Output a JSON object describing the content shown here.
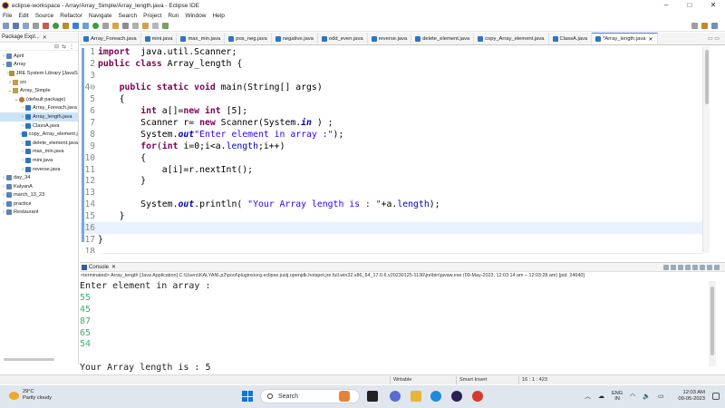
{
  "window": {
    "title": "eclipse-workspace - Array/Array_Simple/Array_length.java - Eclipse IDE",
    "controls": [
      "–",
      "□",
      "✕"
    ]
  },
  "menu": [
    "File",
    "Edit",
    "Source",
    "Refactor",
    "Navigate",
    "Search",
    "Project",
    "Run",
    "Window",
    "Help"
  ],
  "explorer": {
    "title": "Package Expl...",
    "tree": [
      {
        "label": "April",
        "indent": 0,
        "twisty": "›",
        "icon": "proj"
      },
      {
        "label": "Array",
        "indent": 0,
        "twisty": "⌄",
        "icon": "proj"
      },
      {
        "label": "JRE System Library [JavaSE-17]",
        "indent": 1,
        "twisty": "›",
        "icon": "lib"
      },
      {
        "label": "src",
        "indent": 1,
        "twisty": "›",
        "icon": "src"
      },
      {
        "label": "Array_Simple",
        "indent": 1,
        "twisty": "⌄",
        "icon": "src"
      },
      {
        "label": "(default package)",
        "indent": 2,
        "twisty": "⌄",
        "icon": "pkgi"
      },
      {
        "label": "Array_Foreach.java",
        "indent": 3,
        "twisty": "›",
        "icon": "java"
      },
      {
        "label": "Array_length.java",
        "indent": 3,
        "twisty": "›",
        "icon": "java",
        "selected": true
      },
      {
        "label": "ClassA.java",
        "indent": 3,
        "twisty": "›",
        "icon": "java"
      },
      {
        "label": "copy_Array_element.java",
        "indent": 3,
        "twisty": "›",
        "icon": "java"
      },
      {
        "label": "delete_element.java",
        "indent": 3,
        "twisty": "›",
        "icon": "java"
      },
      {
        "label": "max_min.java",
        "indent": 3,
        "twisty": "›",
        "icon": "java"
      },
      {
        "label": "mini.java",
        "indent": 3,
        "twisty": "›",
        "icon": "java"
      },
      {
        "label": "reverse.java",
        "indent": 3,
        "twisty": "›",
        "icon": "java"
      },
      {
        "label": "day_34",
        "indent": 0,
        "twisty": "›",
        "icon": "proj"
      },
      {
        "label": "KalyanA",
        "indent": 0,
        "twisty": "›",
        "icon": "proj"
      },
      {
        "label": "march_13_23",
        "indent": 0,
        "twisty": "›",
        "icon": "proj"
      },
      {
        "label": "practice",
        "indent": 0,
        "twisty": "›",
        "icon": "proj"
      },
      {
        "label": "Restaurant",
        "indent": 0,
        "twisty": "›",
        "icon": "proj"
      }
    ]
  },
  "tabs": [
    {
      "label": "Array_Foreach.java",
      "active": false
    },
    {
      "label": "mini.java",
      "active": false
    },
    {
      "label": "max_min.java",
      "active": false
    },
    {
      "label": "pos_neg.java",
      "active": false
    },
    {
      "label": "negative.java",
      "active": false
    },
    {
      "label": "odd_even.java",
      "active": false
    },
    {
      "label": "reverse.java",
      "active": false
    },
    {
      "label": "delete_element.java",
      "active": false
    },
    {
      "label": "copy_Array_element.java",
      "active": false
    },
    {
      "label": "ClassA.java",
      "active": false
    },
    {
      "label": "*Array_length.java",
      "active": true
    }
  ],
  "editor": {
    "current_line": 16,
    "lines": [
      {
        "n": "1",
        "segs": [
          [
            "kw",
            "import"
          ],
          [
            "",
            "  java.util.Scanner;"
          ]
        ]
      },
      {
        "n": "2",
        "segs": [
          [
            "kw",
            "public class"
          ],
          [
            "",
            " Array_length {"
          ]
        ]
      },
      {
        "n": "3",
        "segs": []
      },
      {
        "n": "4⊖",
        "segs": [
          [
            "",
            "    "
          ],
          [
            "kw",
            "public static void"
          ],
          [
            "",
            " main(String[] args)"
          ]
        ]
      },
      {
        "n": "5",
        "segs": [
          [
            "",
            "    {"
          ]
        ]
      },
      {
        "n": "6",
        "segs": [
          [
            "",
            "        "
          ],
          [
            "kw",
            "int"
          ],
          [
            "",
            " a[]="
          ],
          [
            "kw",
            "new"
          ],
          [
            "kw",
            " int"
          ],
          [
            "",
            " [5];"
          ]
        ]
      },
      {
        "n": "7",
        "segs": [
          [
            "",
            "        Scanner r= "
          ],
          [
            "kw",
            "new"
          ],
          [
            "",
            " Scanner(System."
          ],
          [
            "static-f",
            "in"
          ],
          [
            "",
            " ) ;"
          ]
        ]
      },
      {
        "n": "8",
        "segs": [
          [
            "",
            "        System."
          ],
          [
            "static-f",
            "out"
          ],
          [
            ".println("
          ],
          [
            "str",
            "\"Enter element in array :\""
          ],
          [
            "",
            ");"
          ]
        ]
      },
      {
        "n": "9",
        "segs": [
          [
            "",
            "        "
          ],
          [
            "kw",
            "for"
          ],
          [
            "",
            "("
          ],
          [
            "kw",
            "int"
          ],
          [
            "",
            " i=0;i<a."
          ],
          [
            "fld",
            "length"
          ],
          [
            "",
            ";i++)"
          ]
        ]
      },
      {
        "n": "10",
        "segs": [
          [
            "",
            "        {"
          ]
        ]
      },
      {
        "n": "11",
        "segs": [
          [
            "",
            "            a[i]=r.nextInt();"
          ]
        ]
      },
      {
        "n": "12",
        "segs": [
          [
            "",
            "        }"
          ]
        ]
      },
      {
        "n": "13",
        "segs": []
      },
      {
        "n": "14",
        "segs": [
          [
            "",
            "        System."
          ],
          [
            "static-f",
            "out"
          ],
          [
            "",
            ".println( "
          ],
          [
            "str",
            "\"Your Array length is : \""
          ],
          [
            "",
            "+a."
          ],
          [
            "fld",
            "length"
          ],
          [
            "",
            ");"
          ]
        ]
      },
      {
        "n": "15",
        "segs": [
          [
            "",
            "    }"
          ]
        ]
      },
      {
        "n": "16",
        "segs": []
      },
      {
        "n": "17",
        "segs": [
          [
            "",
            "}"
          ]
        ]
      },
      {
        "n": "18",
        "segs": []
      }
    ]
  },
  "console": {
    "title": "Console",
    "info": "<terminated> Array_length [Java Application] C:\\Users\\KALYAN\\.p2\\pool\\plugins\\org.eclipse.justj.openjdk.hotspot.jre.full.win32.x86_64_17.0.6.v20230125-1136\\jre\\bin\\javaw.exe  (09-May-2023, 12:03:14 am – 12:03:28 am) [pid: 24640]",
    "lines": [
      {
        "text": "Enter element in array :",
        "input": false
      },
      {
        "text": "55",
        "input": true
      },
      {
        "text": "45",
        "input": true
      },
      {
        "text": "87",
        "input": true
      },
      {
        "text": "65",
        "input": true
      },
      {
        "text": "54",
        "input": true
      },
      {
        "text": "",
        "input": false
      },
      {
        "text": "Your Array length is : 5",
        "input": false
      }
    ]
  },
  "status": {
    "writable": "Writable",
    "insert_mode": "Smart Insert",
    "position": "16 : 1 : 423"
  },
  "taskbar": {
    "weather_temp": "29°C",
    "weather_desc": "Partly cloudy",
    "search_label": "Search",
    "lang_line1": "ENG",
    "lang_line2": "IN",
    "time": "12:03 AM",
    "date": "09-05-2023"
  }
}
